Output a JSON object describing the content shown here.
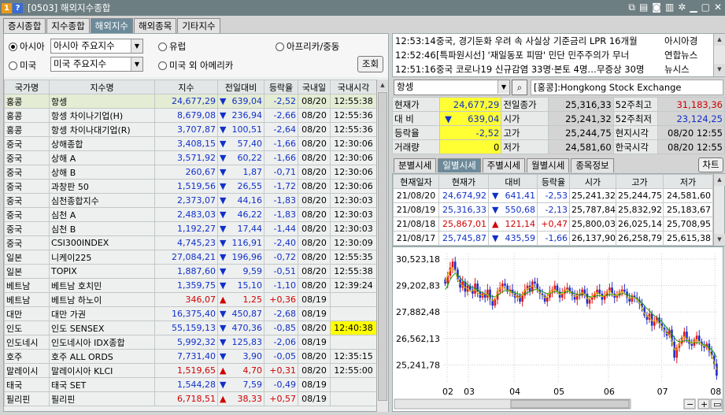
{
  "window": {
    "badge1": "1",
    "badge2": "?",
    "title": "[0503] 해외지수종합"
  },
  "tabs": [
    "증시종합",
    "지수종합",
    "해외지수",
    "해외종목",
    "기타지수"
  ],
  "filter": {
    "asia_label": "아시아",
    "asia_value": "아시아 주요지수",
    "us_label": "미국",
    "us_value": "미국 주요지수",
    "europe_label": "유럽",
    "africa_label": "아프리카/중동",
    "americas_label": "미국 외 아메리카",
    "search_button": "조회"
  },
  "table": {
    "headers": [
      "국가명",
      "지수명",
      "지수",
      "전일대비",
      "등락율",
      "국내일",
      "국내시각"
    ],
    "rows": [
      [
        "홍콩",
        "항셍",
        "24,677,29",
        "▼",
        "639,04",
        "-2,52",
        "08/20",
        "12:55:38",
        "dn"
      ],
      [
        "홍콩",
        "항셍 차이나기업(H)",
        "8,679,08",
        "▼",
        "236,94",
        "-2,66",
        "08/20",
        "12:55:36",
        "dn"
      ],
      [
        "홍콩",
        "항셍 차이나대기업(R)",
        "3,707,87",
        "▼",
        "100,51",
        "-2,64",
        "08/20",
        "12:55:36",
        "dn"
      ],
      [
        "중국",
        "상해종합",
        "3,408,15",
        "▼",
        "57,40",
        "-1,66",
        "08/20",
        "12:30:06",
        "dn"
      ],
      [
        "중국",
        "상해 A",
        "3,571,92",
        "▼",
        "60,22",
        "-1,66",
        "08/20",
        "12:30:06",
        "dn"
      ],
      [
        "중국",
        "상해 B",
        "260,67",
        "▼",
        "1,87",
        "-0,71",
        "08/20",
        "12:30:06",
        "dn"
      ],
      [
        "중국",
        "과창판 50",
        "1,519,56",
        "▼",
        "26,55",
        "-1,72",
        "08/20",
        "12:30:06",
        "dn"
      ],
      [
        "중국",
        "심천종합지수",
        "2,373,07",
        "▼",
        "44,16",
        "-1,83",
        "08/20",
        "12:30:03",
        "dn"
      ],
      [
        "중국",
        "심천 A",
        "2,483,03",
        "▼",
        "46,22",
        "-1,83",
        "08/20",
        "12:30:03",
        "dn"
      ],
      [
        "중국",
        "심천 B",
        "1,192,27",
        "▼",
        "17,44",
        "-1,44",
        "08/20",
        "12:30:03",
        "dn"
      ],
      [
        "중국",
        "CSI300INDEX",
        "4,745,23",
        "▼",
        "116,91",
        "-2,40",
        "08/20",
        "12:30:09",
        "dn"
      ],
      [
        "일본",
        "니케이225",
        "27,084,21",
        "▼",
        "196,96",
        "-0,72",
        "08/20",
        "12:55:35",
        "dn"
      ],
      [
        "일본",
        "TOPIX",
        "1,887,60",
        "▼",
        "9,59",
        "-0,51",
        "08/20",
        "12:55:38",
        "dn"
      ],
      [
        "베트남",
        "베트남 호치민",
        "1,359,75",
        "▼",
        "15,10",
        "-1,10",
        "08/20",
        "12:39:24",
        "dn"
      ],
      [
        "베트남",
        "베트남 하노이",
        "346,07",
        "▲",
        "1,25",
        "+0,36",
        "08/19",
        "",
        "up"
      ],
      [
        "대만",
        "대만 가권",
        "16,375,40",
        "▼",
        "450,87",
        "-2,68",
        "08/19",
        "",
        "dn"
      ],
      [
        "인도",
        "인도 SENSEX",
        "55,159,13",
        "▼",
        "470,36",
        "-0,85",
        "08/20",
        "12:40:38",
        "dn"
      ],
      [
        "인도네시",
        "인도네시아 IDX종합",
        "5,992,32",
        "▼",
        "125,83",
        "-2,06",
        "08/19",
        "",
        "dn"
      ],
      [
        "호주",
        "호주 ALL ORDS",
        "7,731,40",
        "▼",
        "3,90",
        "-0,05",
        "08/20",
        "12:35:15",
        "dn"
      ],
      [
        "말레이시",
        "말레이시아 KLCI",
        "1,519,65",
        "▲",
        "4,70",
        "+0,31",
        "08/20",
        "12:55:00",
        "up"
      ],
      [
        "태국",
        "태국 SET",
        "1,544,28",
        "▼",
        "7,59",
        "-0,49",
        "08/19",
        "",
        "dn"
      ],
      [
        "필리핀",
        "필리핀",
        "6,718,51",
        "▲",
        "38,33",
        "+0,57",
        "08/19",
        "",
        "up"
      ]
    ]
  },
  "news": [
    [
      "12:53:14",
      "중국, 경기둔화 우려 속 사실상 기준금리 LPR 16개월",
      "아시아경"
    ],
    [
      "12:52:46",
      "[특파원시선] '재일동포 피땀' 민단 민주주의가 무너",
      "연합뉴스"
    ],
    [
      "12:51:16",
      "중국 코로나19 신규감염 33명·본토 4명…무증상 30명",
      "뉴시스"
    ]
  ],
  "symbol": {
    "name": "항셍",
    "exchange": "[홍콩]:Hongkong Stock Exchange"
  },
  "quote": {
    "labels": [
      "현재가",
      "대 비",
      "등락율",
      "거래량",
      "전일종가",
      "시가",
      "고가",
      "저가",
      "52주최고",
      "52주최저",
      "현지시각",
      "한국시각"
    ],
    "current": "24,677,29",
    "change_arrow": "▼",
    "change": "639,04",
    "rate": "-2,52",
    "volume": "0",
    "prev_close": "25,316,33",
    "open": "25,241,32",
    "high": "25,244,75",
    "low": "24,581,60",
    "high52": "31,183,36",
    "low52": "23,124,25",
    "local_time": "08/20 12:55",
    "korea_time": "08/20 12:55"
  },
  "subtabs": [
    "분별시세",
    "일별시세",
    "주별시세",
    "월별시세",
    "종목정보"
  ],
  "chart_button": "차트",
  "daily": {
    "headers": [
      "현재일자",
      "현재가",
      "대비",
      "등락율",
      "시가",
      "고가",
      "저가"
    ],
    "rows": [
      [
        "21/08/20",
        "24,674,92",
        "▼",
        "641,41",
        "-2,53",
        "25,241,32",
        "25,244,75",
        "24,581,60",
        "dn"
      ],
      [
        "21/08/19",
        "25,316,33",
        "▼",
        "550,68",
        "-2,13",
        "25,787,84",
        "25,832,92",
        "25,183,67",
        "dn"
      ],
      [
        "21/08/18",
        "25,867,01",
        "▲",
        "121,14",
        "+0,47",
        "25,800,03",
        "26,025,14",
        "25,708,95",
        "up"
      ],
      [
        "21/08/17",
        "25,745,87",
        "▼",
        "435,59",
        "-1,66",
        "26,137,90",
        "26,258,79",
        "25,615,38",
        "dn"
      ]
    ]
  },
  "chart_data": {
    "type": "candlestick",
    "y_ticks": [
      "30,523,18",
      "29,202,83",
      "27,882,48",
      "26,562,13",
      "25,241,78"
    ],
    "x_ticks": [
      "02",
      "03",
      "04",
      "05",
      "06",
      "07",
      "08"
    ],
    "closes": [
      29300,
      29700,
      30100,
      30400,
      30000,
      29500,
      29100,
      29400,
      28900,
      29200,
      29000,
      28800,
      29300,
      28900,
      28600,
      28800,
      28600,
      29000,
      28500,
      28200,
      28500,
      28900,
      29100,
      29300,
      29200,
      28900,
      29000,
      28800,
      28600,
      28700,
      28400,
      28700,
      29000,
      29200,
      28900,
      29400,
      29300,
      29000,
      28800,
      28700,
      28400,
      28600,
      28900,
      29000,
      29200,
      28900,
      28600,
      28800,
      29000,
      29100,
      28900,
      28700,
      28500,
      28800,
      28700,
      29000,
      28800,
      28300,
      28500,
      28600,
      28800,
      29000,
      28800,
      28500,
      28700,
      28900,
      29100,
      28800,
      28600,
      28700,
      28900,
      29000,
      28900,
      28600,
      28400,
      28700,
      28600,
      28500,
      28300,
      28100,
      27700,
      27500,
      27800,
      27200,
      27400,
      27600,
      27300,
      27100,
      26900,
      26700,
      27000,
      26400,
      25600,
      26100,
      26300,
      26600,
      26900,
      26500,
      26300,
      26200,
      26500,
      26700,
      26400,
      26200,
      26100,
      26300,
      25900,
      25700,
      25300,
      24700
    ],
    "ma_fast": [
      29400,
      29700,
      30000,
      30100,
      29900,
      29500,
      29300,
      29200,
      29100,
      29050,
      28900,
      28950,
      29000,
      28850,
      28750,
      28700,
      28800,
      28750,
      28550,
      28450,
      28600,
      28850,
      29050,
      29150,
      29050,
      28950,
      28900,
      28800,
      28700,
      28600,
      28600,
      28750,
      28950,
      29050,
      29100,
      29200,
      29150,
      29000,
      28850,
      28700,
      28600,
      28650,
      28850,
      28950,
      29000,
      28900,
      28750,
      28800,
      28950,
      29000,
      28900,
      28750,
      28650,
      28700,
      28800,
      28850,
      28750,
      28550,
      28550,
      28650,
      28800,
      28850,
      28750,
      28650,
      28700,
      28850,
      28950,
      28800,
      28700,
      28700,
      28850,
      28900,
      28800,
      28650,
      28550,
      28600,
      28600,
      28500,
      28350,
      28100,
      27800,
      27650,
      27650,
      27450,
      27450,
      27450,
      27300,
      27150,
      26950,
      26800,
      26750,
      26450,
      26000,
      26000,
      26250,
      26500,
      26650,
      26550,
      26400,
      26300,
      26400,
      26500,
      26400,
      26250,
      26200,
      26150,
      25950,
      25700,
      25400,
      25000
    ],
    "ma_slow": [
      29000,
      29200,
      29500,
      29700,
      29800,
      29750,
      29600,
      29450,
      29350,
      29250,
      29150,
      29100,
      29050,
      29000,
      28900,
      28850,
      28800,
      28750,
      28700,
      28650,
      28650,
      28700,
      28800,
      28900,
      28950,
      28950,
      28950,
      28900,
      28850,
      28800,
      28750,
      28750,
      28800,
      28850,
      28900,
      28950,
      29000,
      29000,
      28950,
      28900,
      28850,
      28800,
      28800,
      28850,
      28900,
      28900,
      28850,
      28850,
      28850,
      28900,
      28900,
      28850,
      28800,
      28750,
      28750,
      28750,
      28750,
      28700,
      28650,
      28650,
      28650,
      28700,
      28700,
      28700,
      28700,
      28700,
      28750,
      28750,
      28750,
      28700,
      28750,
      28800,
      28800,
      28750,
      28700,
      28650,
      28600,
      28550,
      28450,
      28350,
      28200,
      28050,
      27950,
      27800,
      27700,
      27600,
      27500,
      27400,
      27250,
      27100,
      26950,
      26800,
      26600,
      26450,
      26400,
      26400,
      26450,
      26450,
      26400,
      26350,
      26350,
      26350,
      26350,
      26300,
      26250,
      26200,
      26100,
      26000,
      25850,
      25600
    ]
  }
}
